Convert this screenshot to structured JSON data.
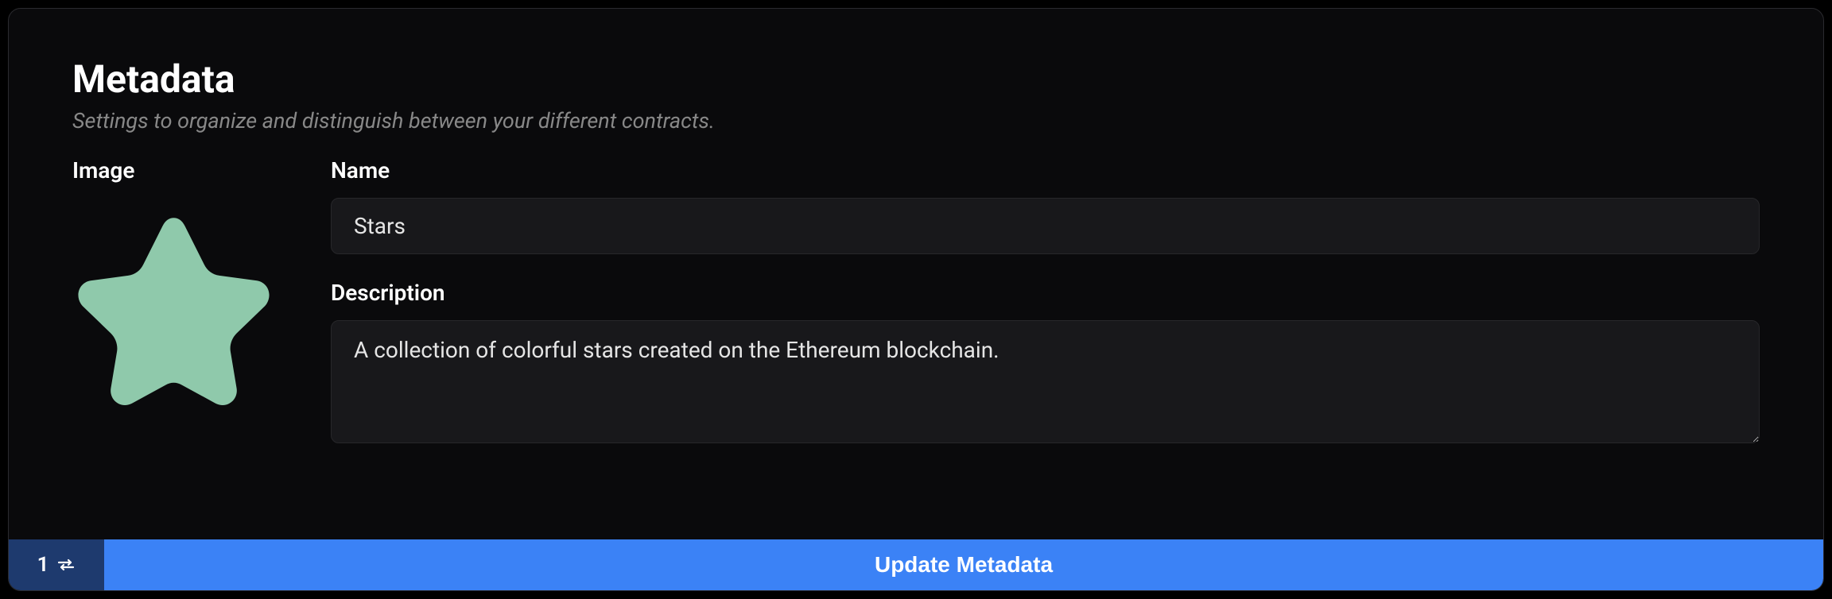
{
  "section": {
    "title": "Metadata",
    "subtitle": "Settings to organize and distinguish between your different contracts."
  },
  "labels": {
    "image": "Image",
    "name": "Name",
    "description": "Description"
  },
  "fields": {
    "name_value": "Stars",
    "description_value": "A collection of colorful stars created on the Ethereum blockchain."
  },
  "image": {
    "icon_name": "star-icon",
    "color": "#8fc9ab"
  },
  "footer": {
    "tx_count": "1",
    "button_label": "Update Metadata"
  },
  "colors": {
    "accent": "#3b82f6",
    "accent_dark": "#1e3a6e",
    "input_bg": "#18181b",
    "card_bg": "#0a0a0c"
  }
}
